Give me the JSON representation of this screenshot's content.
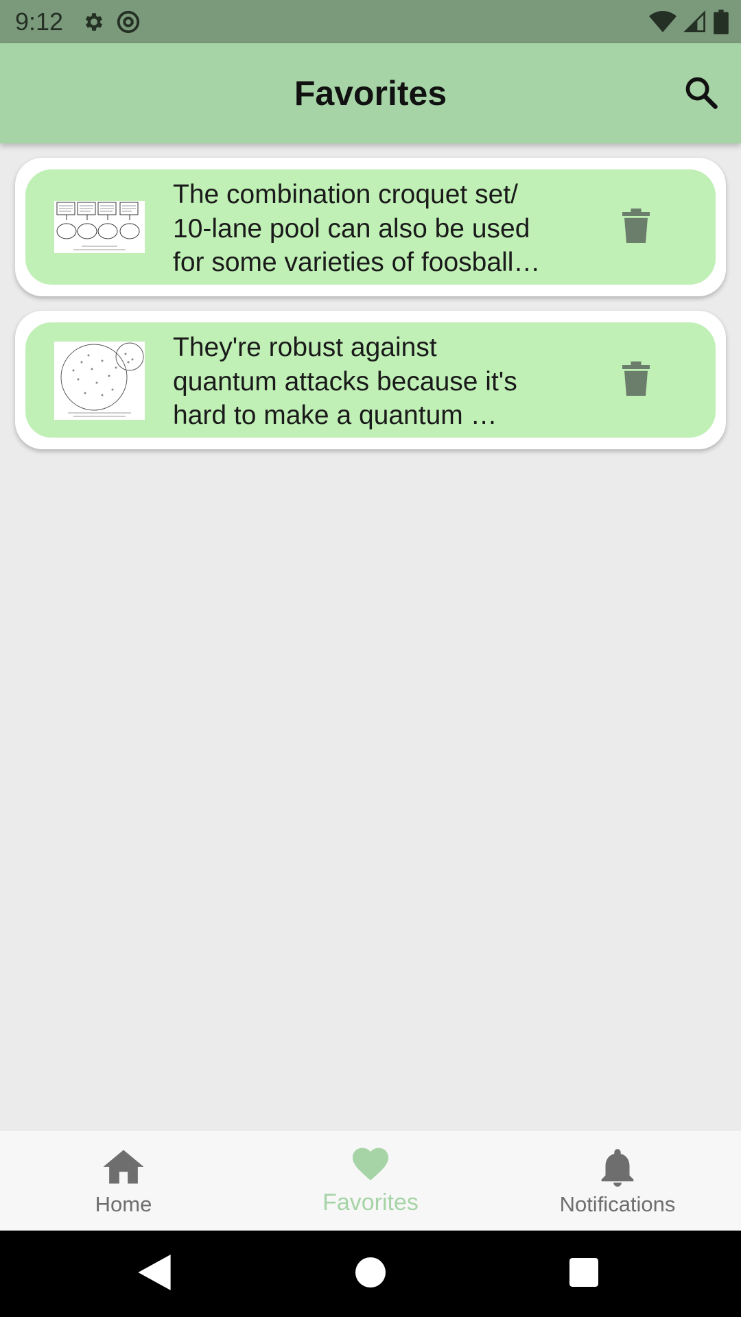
{
  "status_bar": {
    "time": "9:12",
    "icons": [
      "gear-icon",
      "at-sign-icon",
      "wifi-icon",
      "signal-icon",
      "battery-icon"
    ]
  },
  "app_bar": {
    "title": "Favorites",
    "search_icon": "search-icon"
  },
  "favorites": [
    {
      "lines": [
        "The combination croquet set/",
        "10-lane pool can also be used",
        "for some varieties of foosball…"
      ],
      "thumbnail": "comic-thumbnail",
      "delete_icon": "trash-icon"
    },
    {
      "lines": [
        "They're robust against",
        "quantum attacks because it's",
        "hard to make a quantum …"
      ],
      "thumbnail": "comic-thumbnail",
      "delete_icon": "trash-icon"
    }
  ],
  "bottom_nav": {
    "items": [
      {
        "label": "Home",
        "icon": "home-icon"
      },
      {
        "label": "Favorites",
        "icon": "heart-icon",
        "active": true
      },
      {
        "label": "Notifications",
        "icon": "bell-icon"
      }
    ]
  },
  "colors": {
    "status_bar": "#7b997b",
    "app_bar": "#a6d4a6",
    "card_inner": "#c0f0b6",
    "active_nav": "#a6d4a6",
    "icon_gray": "#6b7d6b"
  }
}
